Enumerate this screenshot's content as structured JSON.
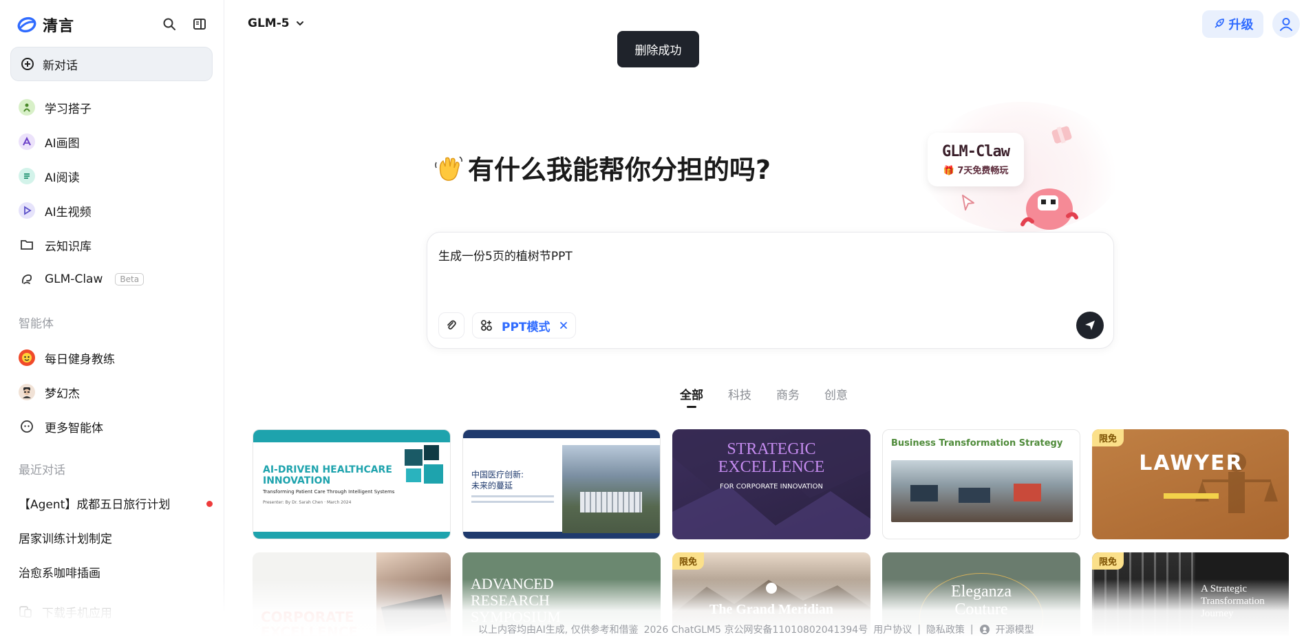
{
  "sidebar": {
    "logo_text": "清言",
    "new_chat": "新对话",
    "nav_items": [
      {
        "label": "学习搭子",
        "icon": "study-icon"
      },
      {
        "label": "AI画图",
        "icon": "paint-icon"
      },
      {
        "label": "AI阅读",
        "icon": "read-icon"
      },
      {
        "label": "AI生视频",
        "icon": "video-icon"
      },
      {
        "label": "云知识库",
        "icon": "folder-icon"
      },
      {
        "label": "GLM-Claw",
        "icon": "claw-icon",
        "badge": "Beta"
      }
    ],
    "agents_title": "智能体",
    "agents": [
      {
        "label": "每日健身教练"
      },
      {
        "label": "梦幻杰"
      },
      {
        "label": "更多智能体"
      }
    ],
    "recent_title": "最近对话",
    "recent": [
      {
        "label": "【Agent】成都五日旅行计划",
        "unread": true
      },
      {
        "label": "居家训练计划制定"
      },
      {
        "label": "治愈系咖啡插画"
      }
    ],
    "download": "下载手机应用"
  },
  "header": {
    "model": "GLM-5",
    "toast": "删除成功",
    "upgrade": "升级"
  },
  "hero": {
    "title": "有什么我能帮你分担的吗?"
  },
  "promo": {
    "title": "GLM-Claw",
    "subtitle": "7天免费畅玩"
  },
  "composer": {
    "text": "生成一份5页的植树节PPT",
    "mode": "PPT模式"
  },
  "tabs": [
    {
      "label": "全部",
      "active": true
    },
    {
      "label": "科技"
    },
    {
      "label": "商务"
    },
    {
      "label": "创意"
    }
  ],
  "templates": [
    {
      "title": "AI-DRIVEN HEALTHCARE INNOVATION",
      "subtitle": "Transforming Patient Care Through Intelligent Systems",
      "meta": "Presenter: By Dr. Sarah Chen · March 2024",
      "theme": "#1ea3ad"
    },
    {
      "title": "中国医疗创新:",
      "title2": "未来的蔓延",
      "theme": "#1f3a6d"
    },
    {
      "title": "STRATEGIC",
      "title2": "EXCELLENCE",
      "subtitle": "FOR CORPORATE INNOVATION",
      "theme": "#3a2b58"
    },
    {
      "title": "Business Transformation Strategy",
      "theme": "#4f8b3a"
    },
    {
      "title": "LAWYER",
      "badge": "限免",
      "theme": "#b9773e"
    },
    {
      "title": "CORPORATE",
      "title2": "EXCELLENCE",
      "theme": "#e94f3c"
    },
    {
      "title": "ADVANCED",
      "title2": "RESEARCH",
      "title3": "SYMPOSIUM",
      "theme": "#6b8870"
    },
    {
      "title": "The Grand Meridian",
      "badge": "限免",
      "theme": "#7a6a5a"
    },
    {
      "title": "Eleganza",
      "title2": "Couture",
      "theme": "#6a7c6e"
    },
    {
      "title": "A Strategic",
      "title2": "Transformation",
      "title3": "Journey",
      "badge": "限免",
      "theme": "#1c1c1c"
    }
  ],
  "footer": {
    "notice": "以上内容均由AI生成, 仅供参考和借鉴",
    "copyright": "2026 ChatGLM5 京公网安备11010802041394号",
    "terms": "用户协议",
    "privacy": "隐私政策",
    "open_source": "开源模型"
  },
  "colors": {
    "accent": "#2f6bff",
    "dark": "#1f232b",
    "unread": "#ee3b3b"
  }
}
